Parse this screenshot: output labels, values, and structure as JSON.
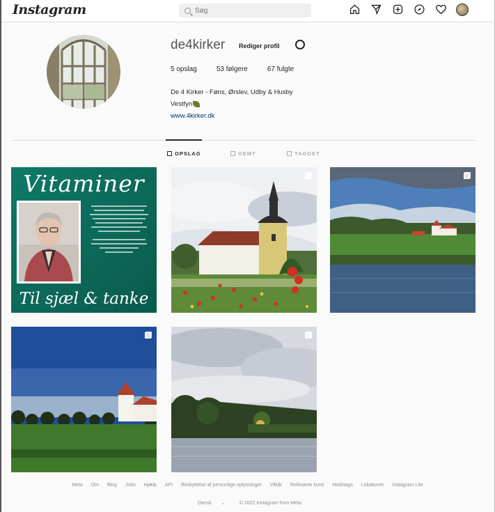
{
  "header": {
    "logo": "Instagram",
    "search_placeholder": "Søg",
    "icons": [
      "home-icon",
      "direct-icon",
      "new-post-icon",
      "explore-icon",
      "heart-icon",
      "profile-avatar-icon"
    ]
  },
  "profile": {
    "username": "de4kirker",
    "edit_label": "Rediger profil",
    "stats": {
      "posts": "5 opslag",
      "followers": "53 følgere",
      "following": "67 fulgte"
    },
    "bio_line1": "De 4 Kirker - Føns, Ørslev, Udby & Husby",
    "bio_line2": "Vestfyn",
    "website": "www.4kirker.dk"
  },
  "tabs": [
    {
      "label": "OPSLAG",
      "active": true
    },
    {
      "label": "GEMT",
      "active": false
    },
    {
      "label": "TAGGET",
      "active": false
    }
  ],
  "posts": [
    {
      "title": "Vitaminer",
      "subtitle": "Til sjæl & tanke",
      "kind": "text-graphic",
      "multi": false
    },
    {
      "kind": "church-poppies",
      "multi": true
    },
    {
      "kind": "church-lake",
      "multi": true
    },
    {
      "kind": "church-field",
      "multi": true
    },
    {
      "kind": "lake-trees",
      "multi": true
    }
  ],
  "footer": {
    "links": [
      "Meta",
      "Om",
      "Blog",
      "Jobs",
      "Hjælp",
      "API",
      "Beskyttelse af personlige oplysninger",
      "Vilkår",
      "Relevante konti",
      "Hashtags",
      "Lokationer",
      "Instagram Lite"
    ],
    "language": "Dansk",
    "copyright": "© 2022 Instagram from Meta"
  },
  "colors": {
    "accent": "#262626",
    "teal": "#0e6e5e",
    "link": "#00376b"
  }
}
